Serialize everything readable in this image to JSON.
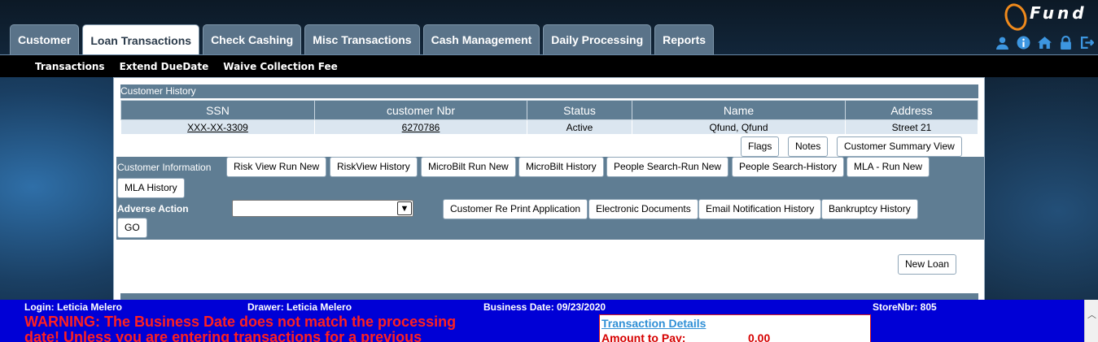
{
  "brand": {
    "logo_text": "Fund"
  },
  "tabs": [
    {
      "label": "Customer"
    },
    {
      "label": "Loan Transactions"
    },
    {
      "label": "Check Cashing"
    },
    {
      "label": "Misc Transactions"
    },
    {
      "label": "Cash Management"
    },
    {
      "label": "Daily Processing"
    },
    {
      "label": "Reports"
    }
  ],
  "submenu": [
    {
      "label": "Transactions"
    },
    {
      "label": "Extend DueDate"
    },
    {
      "label": "Waive Collection Fee"
    }
  ],
  "history": {
    "title": "Customer History",
    "columns": [
      "SSN",
      "customer Nbr",
      "Status",
      "Name",
      "Address"
    ],
    "row": {
      "ssn": "XXX-XX-3309",
      "customer_nbr": "6270786",
      "status": "Active",
      "name": "Qfund,  Qfund",
      "address": "Street 21"
    }
  },
  "top_buttons": {
    "flags": "Flags",
    "notes": "Notes",
    "summary": "Customer Summary View"
  },
  "info": {
    "label": "Customer Information",
    "buttons": [
      "Risk View Run New",
      "RiskView History",
      "MicroBilt Run New",
      "MicroBilt History",
      "People Search-Run New",
      "People Search-History",
      "MLA - Run New",
      "MLA History"
    ]
  },
  "adverse": {
    "label": "Adverse Action",
    "select_value": "",
    "go": "GO",
    "buttons": [
      "Customer Re Print Application",
      "Electronic Documents",
      "Email Notification History",
      "Bankruptcy History"
    ]
  },
  "new_loan": "New Loan",
  "footer": {
    "login": "Login: Leticia Melero",
    "drawer": "Drawer: Leticia Melero",
    "business_date": "Business Date: 09/23/2020",
    "store": "StoreNbr: 805",
    "warning": "WARNING: The Business Date does not match the processing date! Unless you are entering transactions for a previous",
    "tx_title": "Transaction Details",
    "tx_amount_label": "Amount to Pay:",
    "tx_amount_value": "0.00"
  },
  "colors": {
    "tab_bg": "#5a7389",
    "panel_bar": "#5f7d93",
    "footer_bg": "#0000d6",
    "warning": "#ff2020",
    "logo_accent": "#f08a1c"
  }
}
